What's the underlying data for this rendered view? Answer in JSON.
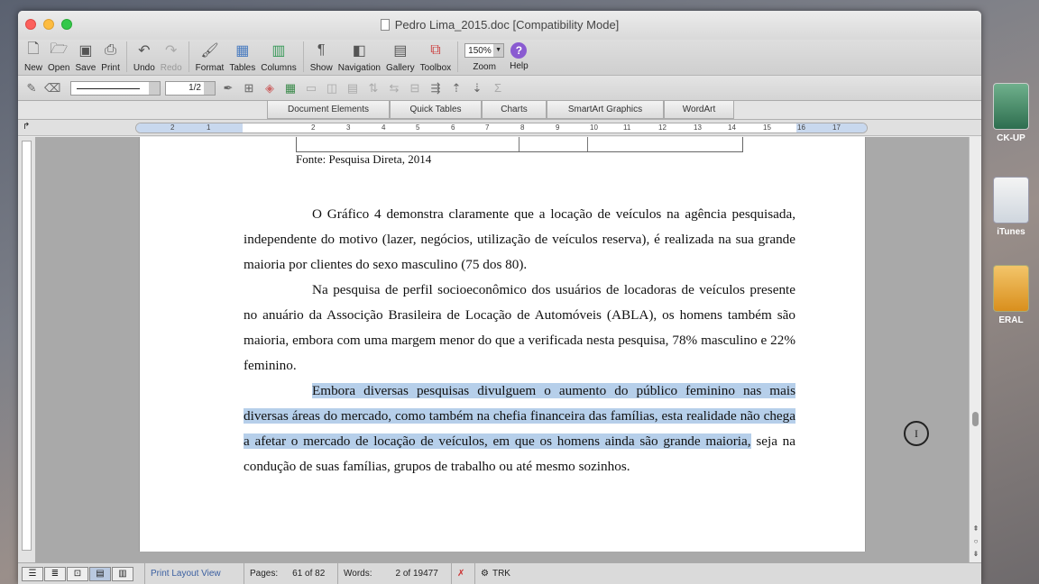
{
  "window": {
    "title": "Pedro Lima_2015.doc [Compatibility Mode]"
  },
  "toolbar": {
    "new": "New",
    "open": "Open",
    "save": "Save",
    "print": "Print",
    "undo": "Undo",
    "redo": "Redo",
    "format": "Format",
    "tables": "Tables",
    "columns": "Columns",
    "show": "Show",
    "navigation": "Navigation",
    "gallery": "Gallery",
    "toolbox": "Toolbox",
    "zoom_value": "150%",
    "zoom": "Zoom",
    "help": "Help"
  },
  "formatbar": {
    "line_width": "1/2"
  },
  "ribbon": {
    "tabs": [
      "Document Elements",
      "Quick Tables",
      "Charts",
      "SmartArt Graphics",
      "WordArt"
    ]
  },
  "ruler": {
    "numbers": [
      "1",
      "2",
      "1",
      "1",
      "2",
      "3",
      "4",
      "5",
      "6",
      "7",
      "8",
      "9",
      "10",
      "11",
      "12",
      "13",
      "14",
      "15",
      "16",
      "17"
    ]
  },
  "document": {
    "source": "Fonte: Pesquisa Direta, 2014",
    "p1": "O Gráfico 4 demonstra claramente que a locação de veículos na agência pesquisada, independente do motivo (lazer, negócios, utilização de veículos reserva), é realizada na sua grande maioria por clientes do sexo masculino (75 dos 80).",
    "p2": "Na pesquisa de perfil socioeconômico dos usuários de locadoras de veículos presente no anuário da Associção Brasileira de Locação de Automóveis (ABLA), os homens também são maioria, embora com uma margem menor do que a verificada nesta pesquisa, 78% masculino e 22% feminino.",
    "p3_highlighted": "Embora diversas pesquisas divulguem o aumento do público feminino nas mais diversas áreas do mercado, como também na chefia financeira das famílias, esta realidade não chega a afetar o mercado de locação de veículos, em que os homens ainda são grande maioria,",
    "p3_rest": "seja na condução de suas famílias, grupos de trabalho ou até mesmo sozinhos."
  },
  "status": {
    "view": "Print Layout View",
    "pages_label": "Pages:",
    "pages_value": "61 of 82",
    "words_label": "Words:",
    "words_value": "2 of 19477",
    "trk": "TRK"
  },
  "desktop": {
    "apps": [
      "CK-UP",
      "iTunes",
      "ERAL"
    ]
  },
  "colors": {
    "highlight": "#b6cfea",
    "close": "#fc605c",
    "minimize": "#fdbc40",
    "maximize": "#34c84a"
  }
}
